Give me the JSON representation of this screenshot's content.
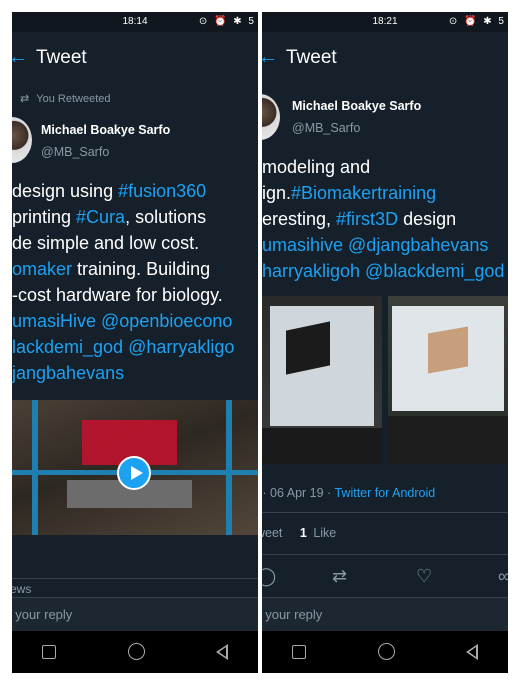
{
  "left": {
    "status_time": "18:14",
    "status_icons": "⊙ ⏰ ✱ 5",
    "header_title": "Tweet",
    "retweet_icon": "⇄",
    "retweet_label": "You Retweeted",
    "author_name": "Michael Boakye Sarfo",
    "author_handle": "@MB_Sarfo",
    "text_lines": [
      [
        {
          "t": "design using ",
          "link": false
        },
        {
          "t": "#fusion360",
          "link": true
        }
      ],
      [
        {
          "t": " printing ",
          "link": false
        },
        {
          "t": "#Cura",
          "link": true
        },
        {
          "t": ", solutions",
          "link": false
        }
      ],
      [
        {
          "t": "de simple and low cost.",
          "link": false
        }
      ],
      [
        {
          "t": "omaker",
          "link": true
        },
        {
          "t": " training. Building",
          "link": false
        }
      ],
      [
        {
          "t": "-cost hardware for biology.",
          "link": false
        }
      ],
      [
        {
          "t": "umasiHive @openbioecono",
          "link": true
        }
      ],
      [
        {
          "t": "lackdemi_god @harryakligo",
          "link": true
        }
      ],
      [
        {
          "t": "jangbahevans",
          "link": true
        }
      ]
    ],
    "views_label": "ews",
    "reply_placeholder": "t your reply"
  },
  "right": {
    "status_time": "18:21",
    "status_icons": "⊙ ⏰ ✱ 5",
    "header_title": "Tweet",
    "author_name": "Michael Boakye Sarfo",
    "author_handle": "@MB_Sarfo",
    "text_lines": [
      [
        {
          "t": "modeling and",
          "link": false
        }
      ],
      [
        {
          "t": "ign.",
          "link": false
        },
        {
          "t": "#Biomakertraining",
          "link": true
        }
      ],
      [
        {
          "t": "eresting, ",
          "link": false
        },
        {
          "t": "#first3D",
          "link": true
        },
        {
          "t": " design",
          "link": false
        }
      ],
      [
        {
          "t": "umasihive @djangbahevans",
          "link": true
        }
      ],
      [
        {
          "t": "harryakligoh @blackdemi_god",
          "link": true
        }
      ]
    ],
    "meta_date": "5 · 06 Apr 19 · ",
    "meta_source": "Twitter for Android",
    "stats_retweet_label": "weet",
    "stats_like_count": "1",
    "stats_like_label": "Like",
    "reply_placeholder": "t your reply"
  },
  "icons": {
    "back": "arrow-left-icon",
    "reply": "reply-icon",
    "retweet": "retweet-icon",
    "like": "heart-icon",
    "share": "share-icon"
  },
  "colors": {
    "background": "#15202b",
    "link": "#1da1f2",
    "muted": "#8899a6",
    "divider": "#38444d"
  }
}
